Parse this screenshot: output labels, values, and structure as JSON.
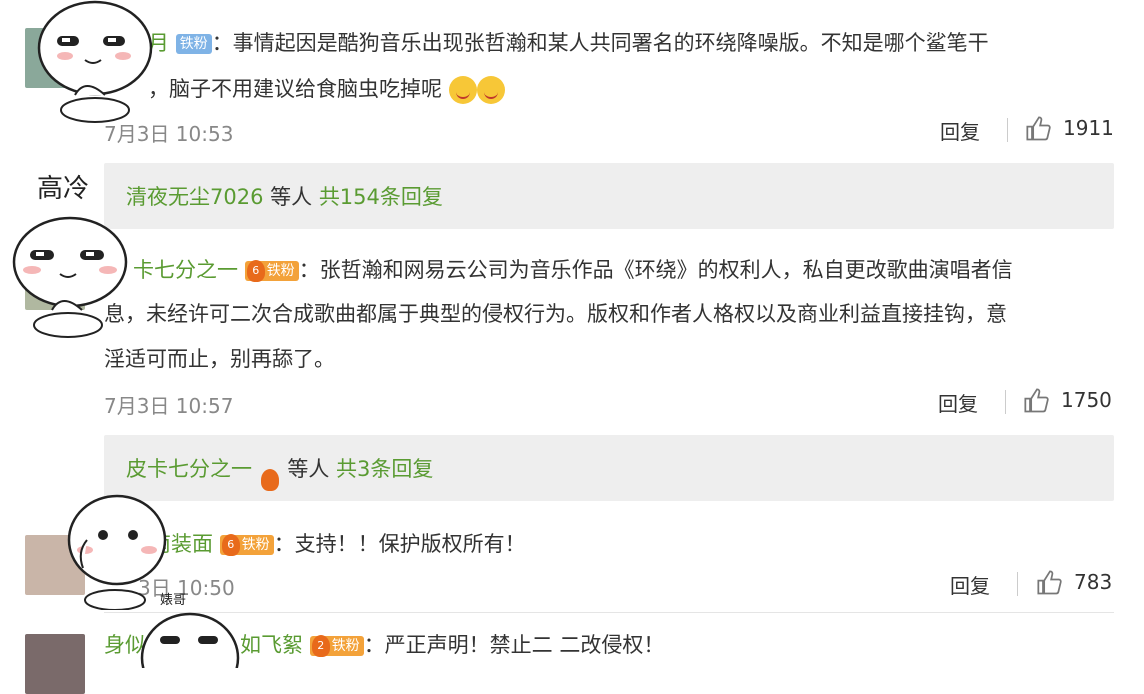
{
  "comments": [
    {
      "user": "月",
      "badge": "铁粉",
      "text_line1": "：事情起因是酷狗音乐出现张哲瀚和某人共同署名的环绕降噪版。不知是哪个鲨笔干",
      "text_line2": "，脑子不用建议给食脑虫吃掉呢",
      "time": "7月3日 10:53",
      "reply_label": "回复",
      "likes": "1911"
    },
    {
      "user": "卡七分之一",
      "badge": "铁粉",
      "badge_level": "6",
      "text_line1": "：张哲瀚和网易云公司为音乐作品《环绕》的权利人，私自更改歌曲演唱者信",
      "text_line2": "息，未经许可二次合成歌曲都属于典型的侵权行为。版权和作者人格权以及商业利益直接挂钩，意",
      "text_line3": "淫适可而止，别再舔了。",
      "time": "7月3日 10:57",
      "reply_label": "回复",
      "likes": "1750"
    },
    {
      "user": "南装面",
      "badge": "铁粉",
      "badge_level": "6",
      "text_line1": "：支持！！保护版权所有！",
      "time": "3日 10:50",
      "reply_label": "回复",
      "likes": "783"
    },
    {
      "user_part1": "身似",
      "user_part2": "如飞絮",
      "badge": "铁粉",
      "badge_level": "2",
      "text_line1": "：严正声明！禁止二 二改侵权！"
    }
  ],
  "reply_summaries": [
    {
      "user": "清夜无尘7026",
      "mid": " 等人 ",
      "count": "共154条回复"
    },
    {
      "user": "皮卡七分之一",
      "mid": " 等人 ",
      "count": "共3条回复"
    }
  ],
  "stickers": {
    "cold_text": "高冷",
    "tiny_text": "婊哥"
  }
}
